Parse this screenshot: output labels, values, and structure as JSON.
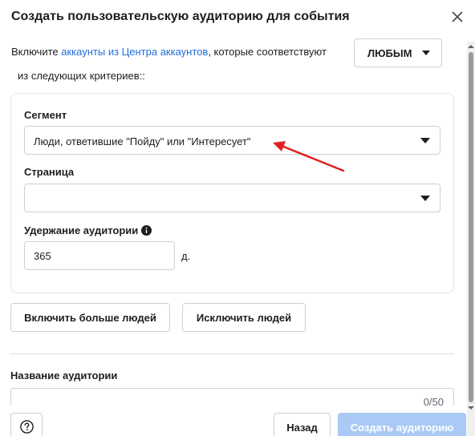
{
  "dialog": {
    "title": "Создать пользовательскую аудиторию для события"
  },
  "intro": {
    "prefix": "Включите ",
    "link": "аккаунты из Центра аккаунтов",
    "suffix": ", которые соответствуют",
    "line2": "из следующих критериев::",
    "match_select": "ЛЮБЫМ"
  },
  "segment": {
    "label": "Сегмент",
    "value": "Люди, ответившие \"Пойду\" или \"Интересует\""
  },
  "page": {
    "label": "Страница",
    "value": ""
  },
  "retention": {
    "label": "Удержание аудитории",
    "value": "365",
    "unit": "д."
  },
  "actions": {
    "include_more": "Включить больше людей",
    "exclude": "Исключить людей"
  },
  "audience_name": {
    "label": "Название аудитории",
    "value": "",
    "counter": "0/50"
  },
  "footer": {
    "back": "Назад",
    "create": "Создать аудиторию"
  },
  "colors": {
    "link": "#216fdb",
    "primary_disabled": "#aac9f5",
    "annotation_arrow": "#e02020"
  },
  "icons": {
    "close": "close-icon",
    "caret": "caret-down-icon",
    "info": "info-icon",
    "help": "question-circle-icon"
  }
}
